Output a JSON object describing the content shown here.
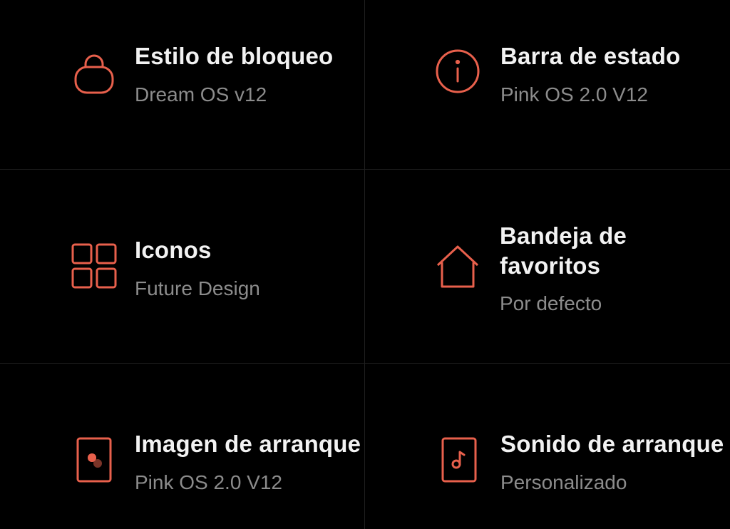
{
  "accent_color": "#e8604c",
  "tiles": [
    {
      "icon": "lock-icon",
      "title": "Estilo de bloqueo",
      "subtitle": "Dream OS v12"
    },
    {
      "icon": "info-icon",
      "title": "Barra de estado",
      "subtitle": "Pink OS 2.0 V12"
    },
    {
      "icon": "grid-icon",
      "title": "Iconos",
      "subtitle": "Future Design"
    },
    {
      "icon": "home-icon",
      "title_line1": "Bandeja de",
      "title_line2": "favoritos",
      "subtitle": "Por defecto"
    },
    {
      "icon": "boot-image-icon",
      "title": "Imagen de arranque",
      "subtitle": "Pink OS 2.0 V12"
    },
    {
      "icon": "music-file-icon",
      "title": "Sonido de arranque",
      "subtitle": "Personalizado"
    }
  ]
}
